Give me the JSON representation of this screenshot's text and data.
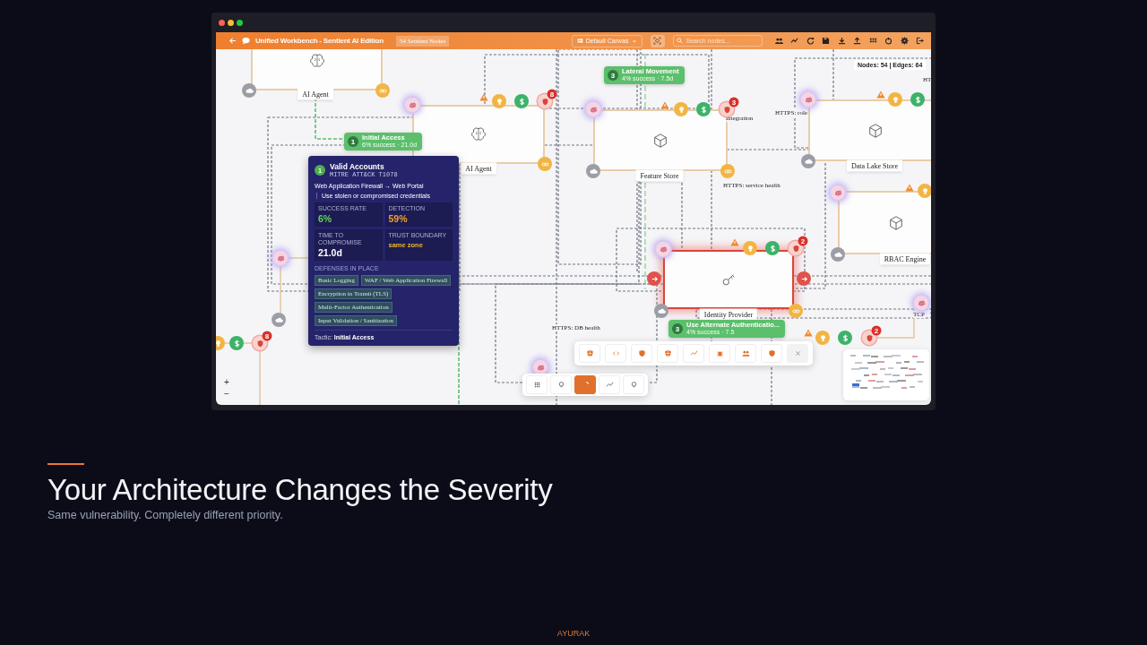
{
  "window": {
    "title": "Unified Workbench - Sentient AI Edition",
    "node_count_chip": "54 Sentient Nodes",
    "canvas_select": "Default Canvas",
    "search": {
      "placeholder": "Search nodes..."
    }
  },
  "canvas": {
    "stats": "Nodes: 54 | Edges: 64",
    "nodes": [
      {
        "label": "AI Agent",
        "highlighted": false
      },
      {
        "label": "AI Agent",
        "highlighted": false
      },
      {
        "label": "Feature Store",
        "highlighted": false
      },
      {
        "label": "Data Lake Store",
        "highlighted": false
      },
      {
        "label": "RBAC Engine",
        "highlighted": false
      },
      {
        "label": "Identity Provider",
        "highlighted": true
      }
    ],
    "edge_labels": [
      "HT",
      "HTTPS: role",
      "integration",
      "HTTPS: service health",
      "HTTPS: DB health",
      "TCP"
    ],
    "risk_badges": [
      "8",
      "3",
      "2",
      "2",
      "8"
    ],
    "attack_steps": [
      {
        "step": "1",
        "title": "Initial Access",
        "detail": "6% success · 21.0d"
      },
      {
        "step": "3",
        "title": "Lateral Movement",
        "detail": "4% success · 7.5d"
      },
      {
        "step": "3",
        "title": "Use Alternate Authenticatio...",
        "detail": "4% success · 7.5"
      }
    ],
    "tooltip": {
      "step": "1",
      "title": "Valid Accounts",
      "technique": "MITRE ATT&CK T1078",
      "path": "Web Application Firewall → Web Portal",
      "description": "Use stolen or compromised credentials",
      "metrics": [
        {
          "label": "SUCCESS RATE",
          "value": "6%",
          "color": "#5fd35f"
        },
        {
          "label": "DETECTION",
          "value": "59%",
          "color": "#f0a030"
        },
        {
          "label": "TIME TO COMPROMISE",
          "value": "21.0d",
          "color": "#ffffff"
        },
        {
          "label": "TRUST BOUNDARY",
          "value": "same zone",
          "color": "#f0b429"
        }
      ],
      "defenses_heading": "DEFENSES IN PLACE",
      "defenses": [
        "Basic Logging",
        "WAF / Web Application Firewall",
        "Encryption in Transit (TLS)",
        "Multi-Factor Authentication",
        "Input Validation / Sanitization"
      ],
      "tactic_label": "Tactic:",
      "tactic": "Initial Access"
    },
    "view_modes": [
      {
        "selected": false
      },
      {
        "selected": false
      },
      {
        "selected": true
      },
      {
        "selected": false
      },
      {
        "selected": false
      }
    ],
    "zoom_controls": [
      "+",
      "−"
    ]
  },
  "slide": {
    "heading": "Your Architecture Changes the Severity",
    "subheading": "Same vulnerability. Completely different priority.",
    "footer": "AYURAK"
  }
}
